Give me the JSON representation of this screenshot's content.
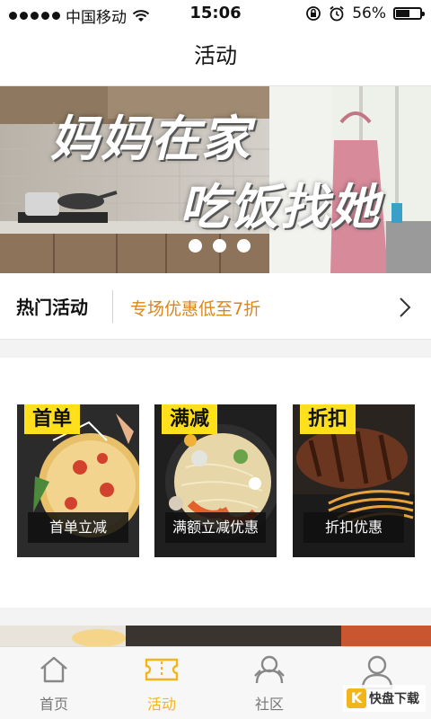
{
  "status_bar": {
    "carrier": "中国移动",
    "time": "15:06",
    "battery": "56%",
    "battery_level": 0.56
  },
  "nav": {
    "title": "活动"
  },
  "banner": {
    "line1": "妈妈在家",
    "line2": "吃饭找她",
    "page_count": 3
  },
  "hot": {
    "label": "热门活动",
    "promo": "专场优惠低至7折"
  },
  "cards": [
    {
      "tag": "首单",
      "caption": "首单立减"
    },
    {
      "tag": "满减",
      "caption": "满额立减优惠"
    },
    {
      "tag": "折扣",
      "caption": "折扣优惠"
    }
  ],
  "tabs": [
    {
      "label": "首页",
      "icon": "home-icon",
      "active": false
    },
    {
      "label": "活动",
      "icon": "ticket-icon",
      "active": true
    },
    {
      "label": "社区",
      "icon": "community-icon",
      "active": false
    },
    {
      "label": "",
      "icon": "user-icon",
      "active": false
    }
  ],
  "watermark": {
    "letter": "K",
    "text": "快盘下载"
  },
  "colors": {
    "accent": "#f2b51c",
    "promo": "#d9871a",
    "tag": "#ffe01b"
  }
}
